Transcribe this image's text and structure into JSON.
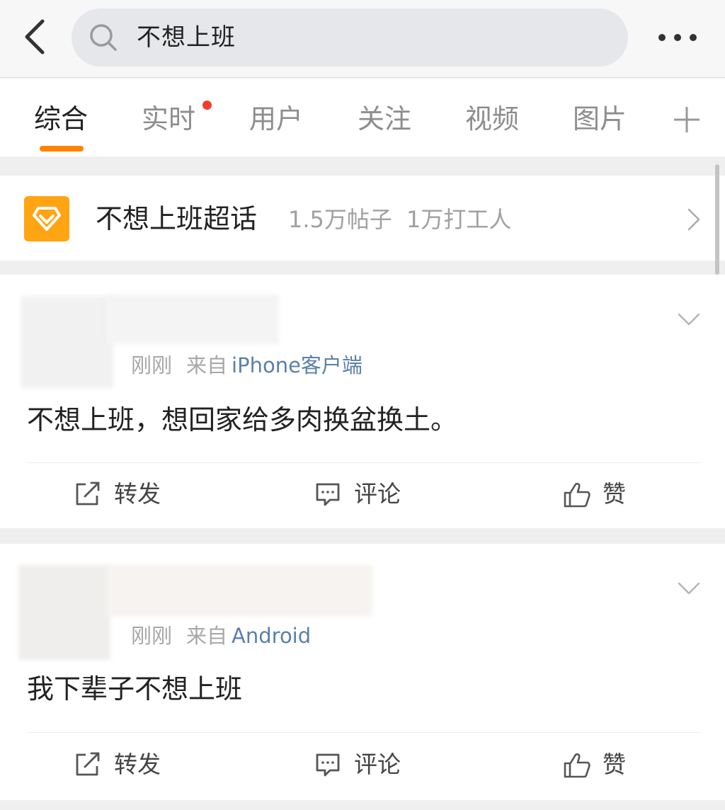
{
  "search": {
    "query": "不想上班"
  },
  "tabs": [
    {
      "label": "综合"
    },
    {
      "label": "实时"
    },
    {
      "label": "用户"
    },
    {
      "label": "关注"
    },
    {
      "label": "视频"
    },
    {
      "label": "图片"
    }
  ],
  "topic": {
    "title": "不想上班超话",
    "posts_count": "1.5万帖子",
    "members_count": "1万打工人"
  },
  "posts": [
    {
      "time": "刚刚",
      "from_label": "来自",
      "source": "iPhone客户端",
      "text": "不想上班，想回家给多肉换盆换土。",
      "actions": {
        "repost": "转发",
        "comment": "评论",
        "like": "赞"
      }
    },
    {
      "time": "刚刚",
      "from_label": "来自",
      "source": "Android",
      "text": "我下辈子不想上班",
      "actions": {
        "repost": "转发",
        "comment": "评论",
        "like": "赞"
      }
    }
  ],
  "colors": {
    "accent": "#ff8200",
    "badge": "#f23d2c",
    "topic_logo": "#ffa412",
    "source_link": "#5b80a8"
  },
  "icons": [
    "back-arrow-icon",
    "search-icon",
    "more-icon",
    "add-icon",
    "diamond-icon",
    "chevron-right-icon",
    "chevron-down-icon",
    "repost-icon",
    "comment-icon",
    "like-icon"
  ]
}
